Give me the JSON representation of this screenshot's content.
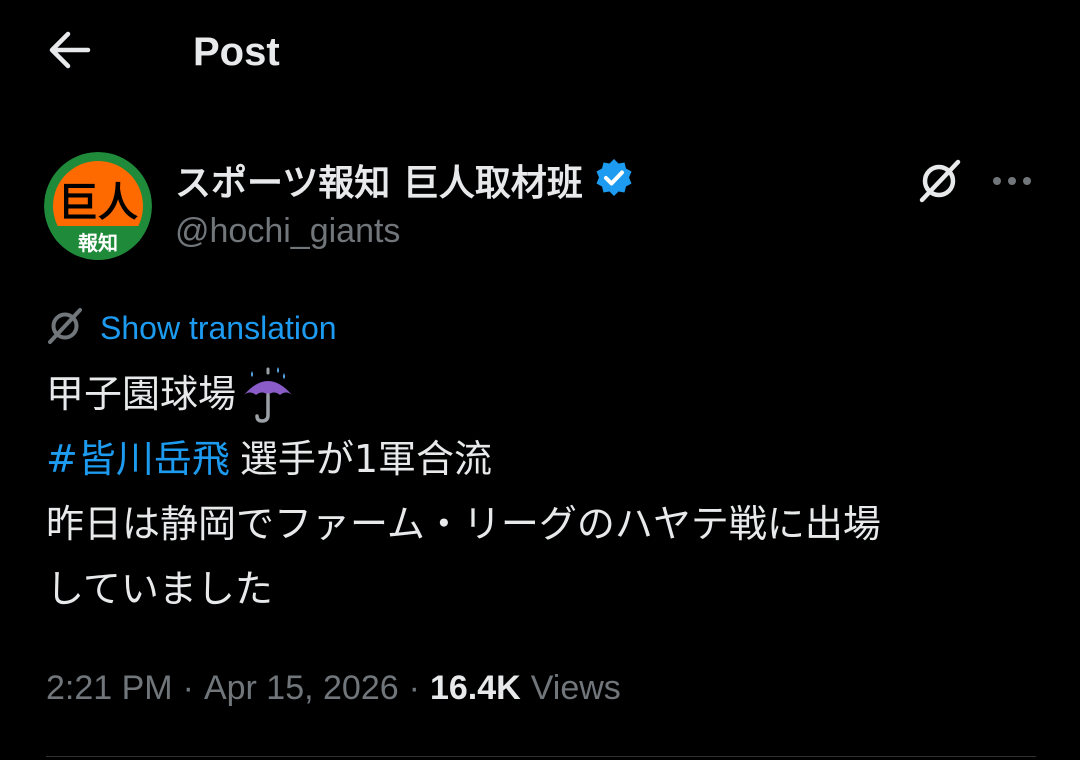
{
  "header": {
    "title": "Post",
    "back_icon": "arrow-left-icon"
  },
  "author": {
    "display_name": "スポーツ報知 巨人取材班",
    "handle": "@hochi_giants",
    "verified": true,
    "verified_color": "#1d9bf0",
    "avatar": {
      "top_text": "巨人",
      "bottom_text": "報知",
      "ring_color": "#1f8a3a",
      "fill_color": "#ff6a00"
    },
    "grok_icon": "grok-icon",
    "more_icon": "more-horizontal-icon"
  },
  "translation": {
    "label": "Show translation",
    "icon": "grok-icon",
    "color": "#1d9bf0"
  },
  "tweet": {
    "line1": "甲子園球場",
    "line1_emoji": "umbrella-rain-icon",
    "hashtag": "#皆川岳飛",
    "line2_rest": "選手が1軍合流",
    "line3": "昨日は静岡でファーム・リーグのハヤテ戦に出場",
    "line4": "していました"
  },
  "meta": {
    "time": "2:21 PM",
    "separator": "·",
    "date": "Apr 15, 2026",
    "views_count": "16.4K",
    "views_label": "Views"
  },
  "colors": {
    "background": "#000000",
    "text": "#e7e9ea",
    "secondary": "#71767b",
    "accent": "#1d9bf0"
  }
}
